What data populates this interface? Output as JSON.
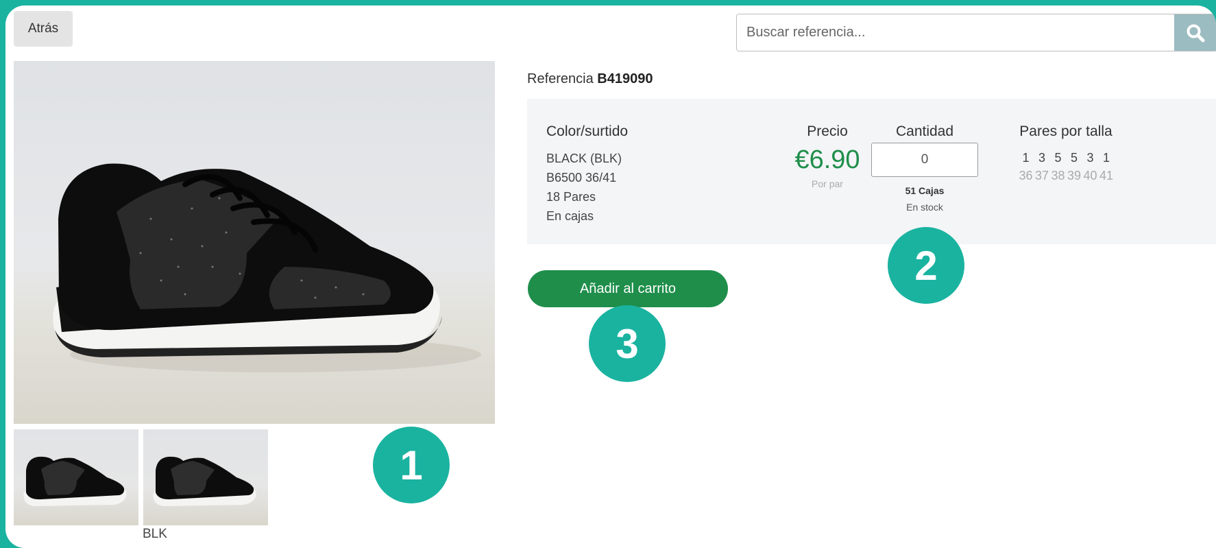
{
  "header": {
    "back_label": "Atrás",
    "search_placeholder": "Buscar referencia..."
  },
  "product": {
    "reference_label": "Referencia",
    "reference_code": "B419090",
    "image_name": "black-glitter-sneaker",
    "thumbnail_label": "BLK"
  },
  "details": {
    "color_header": "Color/surtido",
    "color_lines": [
      "BLACK (BLK)",
      "B6500 36/41",
      "18 Pares",
      "En cajas"
    ],
    "price_header": "Precio",
    "price": "€6.90",
    "price_unit": "Por par",
    "quantity_header": "Cantidad",
    "quantity_value": "0",
    "boxes": "51 Cajas",
    "stock": "En stock",
    "sizes_header": "Pares por talla",
    "pairs": [
      "1",
      "3",
      "5",
      "5",
      "3",
      "1"
    ],
    "sizes": [
      "36",
      "37",
      "38",
      "39",
      "40",
      "41"
    ]
  },
  "actions": {
    "add_to_cart_label": "Añadir al carrito"
  },
  "callouts": [
    "1",
    "2",
    "3"
  ],
  "colors": {
    "accent_teal": "#1ab3a0",
    "price_green": "#1e8e4a",
    "button_green": "#1e8e4a",
    "panel_bg": "#f3f5f7"
  }
}
